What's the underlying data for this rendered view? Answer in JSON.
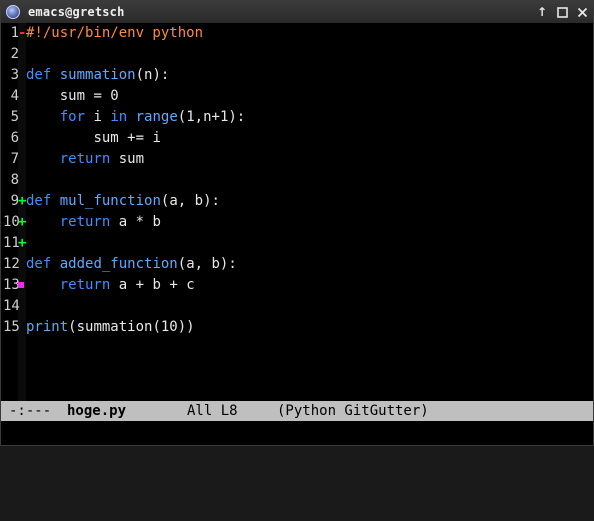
{
  "window": {
    "title": "emacs@gretsch"
  },
  "controls": {
    "pin": "↑",
    "maximize_icon": "maximize",
    "close_icon": "close"
  },
  "editor": {
    "lines": [
      {
        "num": "1",
        "mark": "-",
        "mark_type": "deleted",
        "code": "#!/usr/bin/env python"
      },
      {
        "num": "2",
        "mark": "",
        "mark_type": "none",
        "code": ""
      },
      {
        "num": "3",
        "mark": "",
        "mark_type": "none",
        "code": "def summation(n):"
      },
      {
        "num": "4",
        "mark": "",
        "mark_type": "none",
        "code": "    sum = 0"
      },
      {
        "num": "5",
        "mark": "",
        "mark_type": "none",
        "code": "    for i in range(1,n+1):"
      },
      {
        "num": "6",
        "mark": "",
        "mark_type": "none",
        "code": "        sum += i"
      },
      {
        "num": "7",
        "mark": "",
        "mark_type": "none",
        "code": "    return sum"
      },
      {
        "num": "8",
        "mark": "",
        "mark_type": "none",
        "code": ""
      },
      {
        "num": "9",
        "mark": "+",
        "mark_type": "added",
        "code": "def mul_function(a, b):"
      },
      {
        "num": "10",
        "mark": "+",
        "mark_type": "added",
        "code": "    return a * b"
      },
      {
        "num": "11",
        "mark": "+",
        "mark_type": "added",
        "code": ""
      },
      {
        "num": "12",
        "mark": "",
        "mark_type": "none",
        "code": "def added_function(a, b):"
      },
      {
        "num": "13",
        "mark": "",
        "mark_type": "modified",
        "code": "    return a + b + c"
      },
      {
        "num": "14",
        "mark": "",
        "mark_type": "none",
        "code": ""
      },
      {
        "num": "15",
        "mark": "",
        "mark_type": "none",
        "code": "print(summation(10))"
      }
    ]
  },
  "modeline": {
    "status": "-:---",
    "filename": "hoge.py",
    "position": "All L8",
    "modes": "(Python GitGutter)"
  },
  "colors": {
    "keyword": "#3f8fff",
    "function": "#5fa8ff",
    "string": "#ff8a3d",
    "added": "#00ff33",
    "deleted": "#ff2a2a",
    "modified": "#ff22ff",
    "modeline_bg": "#bfbfbf"
  }
}
